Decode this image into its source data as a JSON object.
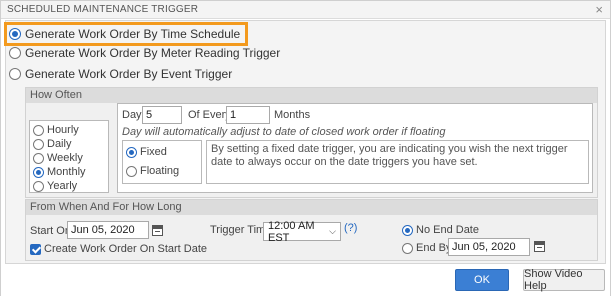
{
  "dialog": {
    "title": "SCHEDULED MAINTENANCE TRIGGER",
    "close_glyph": "×"
  },
  "triggers": [
    {
      "label": "Generate Work Order By Time Schedule",
      "selected": true
    },
    {
      "label": "Generate Work Order By Meter Reading Trigger",
      "selected": false
    },
    {
      "label": "Generate Work Order By Event Trigger",
      "selected": false
    }
  ],
  "how_often": {
    "heading": "How Often",
    "frequencies": [
      {
        "label": "Hourly",
        "selected": false
      },
      {
        "label": "Daily",
        "selected": false
      },
      {
        "label": "Weekly",
        "selected": false
      },
      {
        "label": "Monthly",
        "selected": true
      },
      {
        "label": "Yearly",
        "selected": false
      }
    ],
    "day_label": "Day",
    "day_value": "5",
    "of_every_label": "Of Every",
    "of_every_value": "1",
    "unit_label": "Months",
    "hint": "Day will automatically adjust to date of closed work order if floating",
    "date_mode": [
      {
        "label": "Fixed",
        "selected": true
      },
      {
        "label": "Floating",
        "selected": false
      }
    ],
    "note": "By setting a fixed date trigger, you are indicating you wish the next trigger date to always occur on the date triggers you have set."
  },
  "when": {
    "heading": "From When And For How Long",
    "start_on_label": "Start On",
    "start_on_value": "Jun 05, 2020",
    "create_checkbox_label": "Create Work Order On Start Date",
    "create_checked": true,
    "trigger_time_label": "Trigger Time",
    "trigger_time_value": "12:00 AM EST",
    "help_glyph": "(?)",
    "end_options": [
      {
        "label": "No End Date",
        "selected": true
      },
      {
        "label": "End By",
        "selected": false
      }
    ],
    "end_by_value": "Jun 05, 2020"
  },
  "buttons": {
    "ok": "OK",
    "help": "Show Video Help"
  },
  "colors": {
    "accent": "#2468c0",
    "highlight": "#f39a1e",
    "primary_button": "#3b7fd4"
  },
  "icons": {
    "calendar": "calendar-icon",
    "dropdown": "chevron-down-icon",
    "close": "close-icon"
  }
}
